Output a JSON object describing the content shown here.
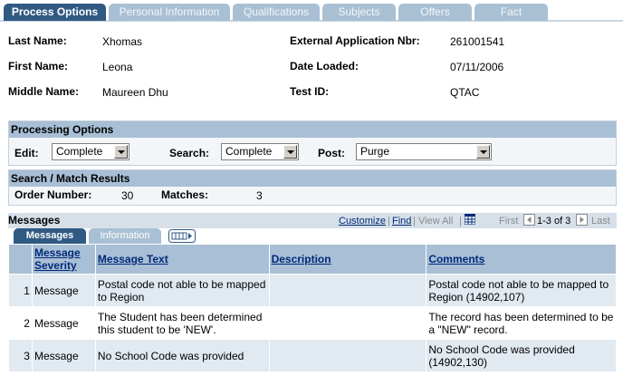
{
  "tabs": [
    {
      "label": "Process Options",
      "active": true
    },
    {
      "label": "Personal Information",
      "active": false
    },
    {
      "label": "Qualifications",
      "active": false
    },
    {
      "label": "Subjects",
      "active": false
    },
    {
      "label": "Offers",
      "active": false
    },
    {
      "label": "Fact",
      "active": false
    }
  ],
  "person": {
    "last_name_label": "Last Name:",
    "last_name": "Xhomas",
    "first_name_label": "First Name:",
    "first_name": "Leona",
    "middle_name_label": "Middle Name:",
    "middle_name": "Maureen Dhu",
    "ext_app_label": "External Application Nbr:",
    "ext_app": "261001541",
    "date_loaded_label": "Date Loaded:",
    "date_loaded": "07/11/2006",
    "test_id_label": "Test ID:",
    "test_id": "QTAC"
  },
  "processing": {
    "title": "Processing Options",
    "edit_label": "Edit:",
    "edit_value": "Complete",
    "search_label": "Search:",
    "search_value": "Complete",
    "post_label": "Post:",
    "post_value": "Purge"
  },
  "match": {
    "title": "Search / Match Results",
    "order_label": "Order Number:",
    "order_value": "30",
    "matches_label": "Matches:",
    "matches_value": "3"
  },
  "messages": {
    "title": "Messages",
    "customize": "Customize",
    "find": "Find",
    "view_all": "View All",
    "first": "First",
    "range": "1-3 of 3",
    "last": "Last",
    "subtabs": [
      "Messages",
      "Information"
    ],
    "columns": [
      "Message Severity",
      "Message Text",
      "Description",
      "Comments"
    ],
    "rows": [
      {
        "num": "1",
        "severity": "Message",
        "text": "Postal code not able to be mapped to Region",
        "description": "",
        "comments": "Postal code not able to be mapped to Region (14902,107)"
      },
      {
        "num": "2",
        "severity": "Message",
        "text": "The Student has been determined this student to be 'NEW'.",
        "description": "",
        "comments": "The record has been determined to be a \"NEW\" record."
      },
      {
        "num": "3",
        "severity": "Message",
        "text": "No School Code was provided",
        "description": "",
        "comments": "No School Code was provided (14902,130)"
      }
    ]
  },
  "icons": {
    "grid_view": "grid-icon",
    "prev": "arrow-left-icon",
    "next": "arrow-right-icon",
    "show_all_columns": "show-all-columns-icon"
  },
  "colors": {
    "tab_active": "#315a83",
    "tab_inactive": "#a9c0d4",
    "box_header": "#a8bfd5",
    "link": "#00297a"
  }
}
